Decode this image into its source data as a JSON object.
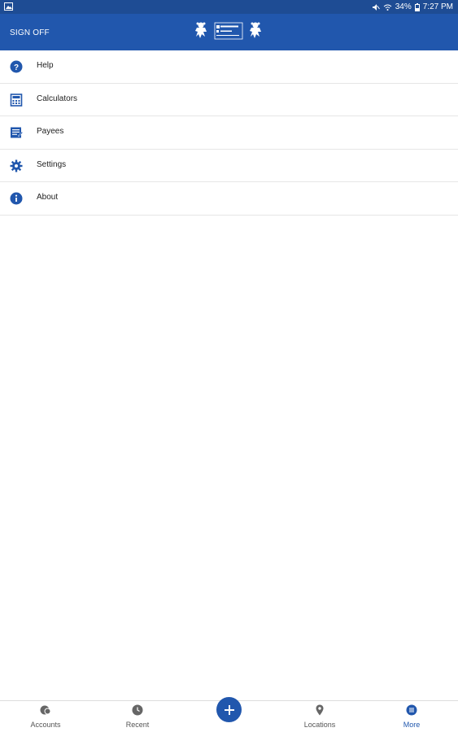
{
  "status_bar": {
    "battery": "34%",
    "time": "7:27 PM",
    "icons": [
      "gallery-icon",
      "mute-icon",
      "wifi-icon",
      "battery-icon"
    ]
  },
  "app_bar": {
    "sign_off_label": "SIGN OFF",
    "logo": "bank-logo"
  },
  "menu": {
    "items": [
      {
        "label": "Help",
        "icon": "help-icon"
      },
      {
        "label": "Calculators",
        "icon": "calculator-icon"
      },
      {
        "label": "Payees",
        "icon": "payees-icon"
      },
      {
        "label": "Settings",
        "icon": "settings-gear-icon"
      },
      {
        "label": "About",
        "icon": "info-icon"
      }
    ]
  },
  "bottom_nav": {
    "items": [
      {
        "label": "Accounts",
        "icon": "accounts-icon",
        "active": false
      },
      {
        "label": "Recent",
        "icon": "recent-icon",
        "active": false
      },
      {
        "label": "Locations",
        "icon": "location-pin-icon",
        "active": false
      },
      {
        "label": "More",
        "icon": "more-icon",
        "active": true
      }
    ],
    "fab_icon": "plus-icon"
  },
  "colors": {
    "status_bar": "#1e4c94",
    "app_bar": "#2157ad",
    "icon_blue": "#2157ad",
    "nav_inactive": "#555555"
  }
}
